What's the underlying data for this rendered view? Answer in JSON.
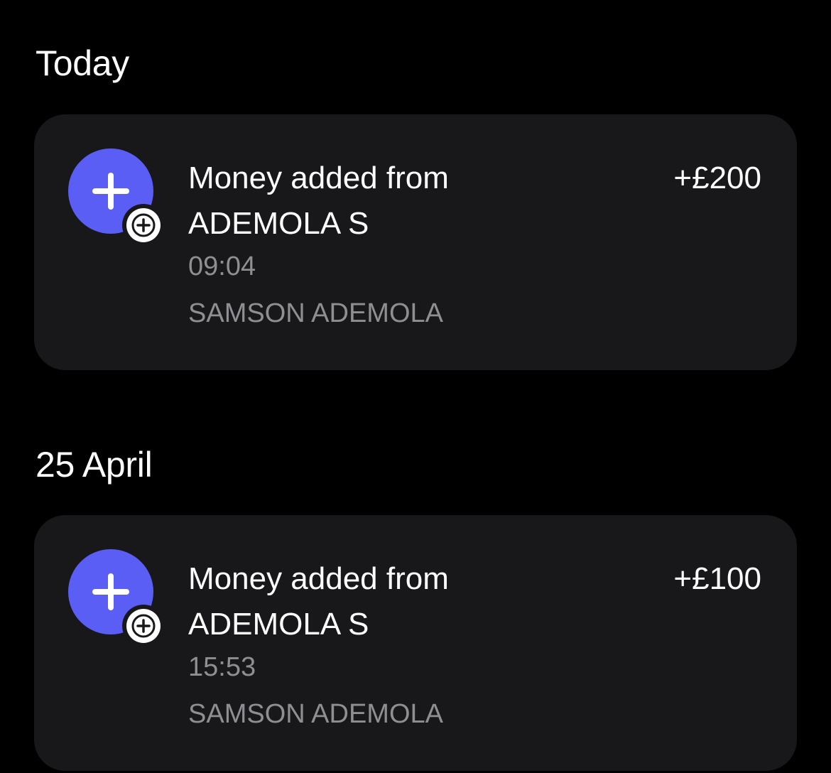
{
  "groups": [
    {
      "heading": "Today",
      "transactions": [
        {
          "title_line1": "Money added from",
          "title_line2": "ADEMOLA S",
          "amount": "+£200",
          "time": "09:04",
          "account": "SAMSON ADEMOLA",
          "icon": "plus-icon",
          "badge_icon": "plus-circle-icon"
        }
      ]
    },
    {
      "heading": "25 April",
      "transactions": [
        {
          "title_line1": "Money added from",
          "title_line2": "ADEMOLA S",
          "amount": "+£100",
          "time": "15:53",
          "account": "SAMSON ADEMOLA",
          "icon": "plus-icon",
          "badge_icon": "plus-circle-icon"
        }
      ]
    }
  ],
  "colors": {
    "background": "#000000",
    "card": "#18181b",
    "accent": "#5b5ef4",
    "secondary_text": "#8e8e93"
  }
}
